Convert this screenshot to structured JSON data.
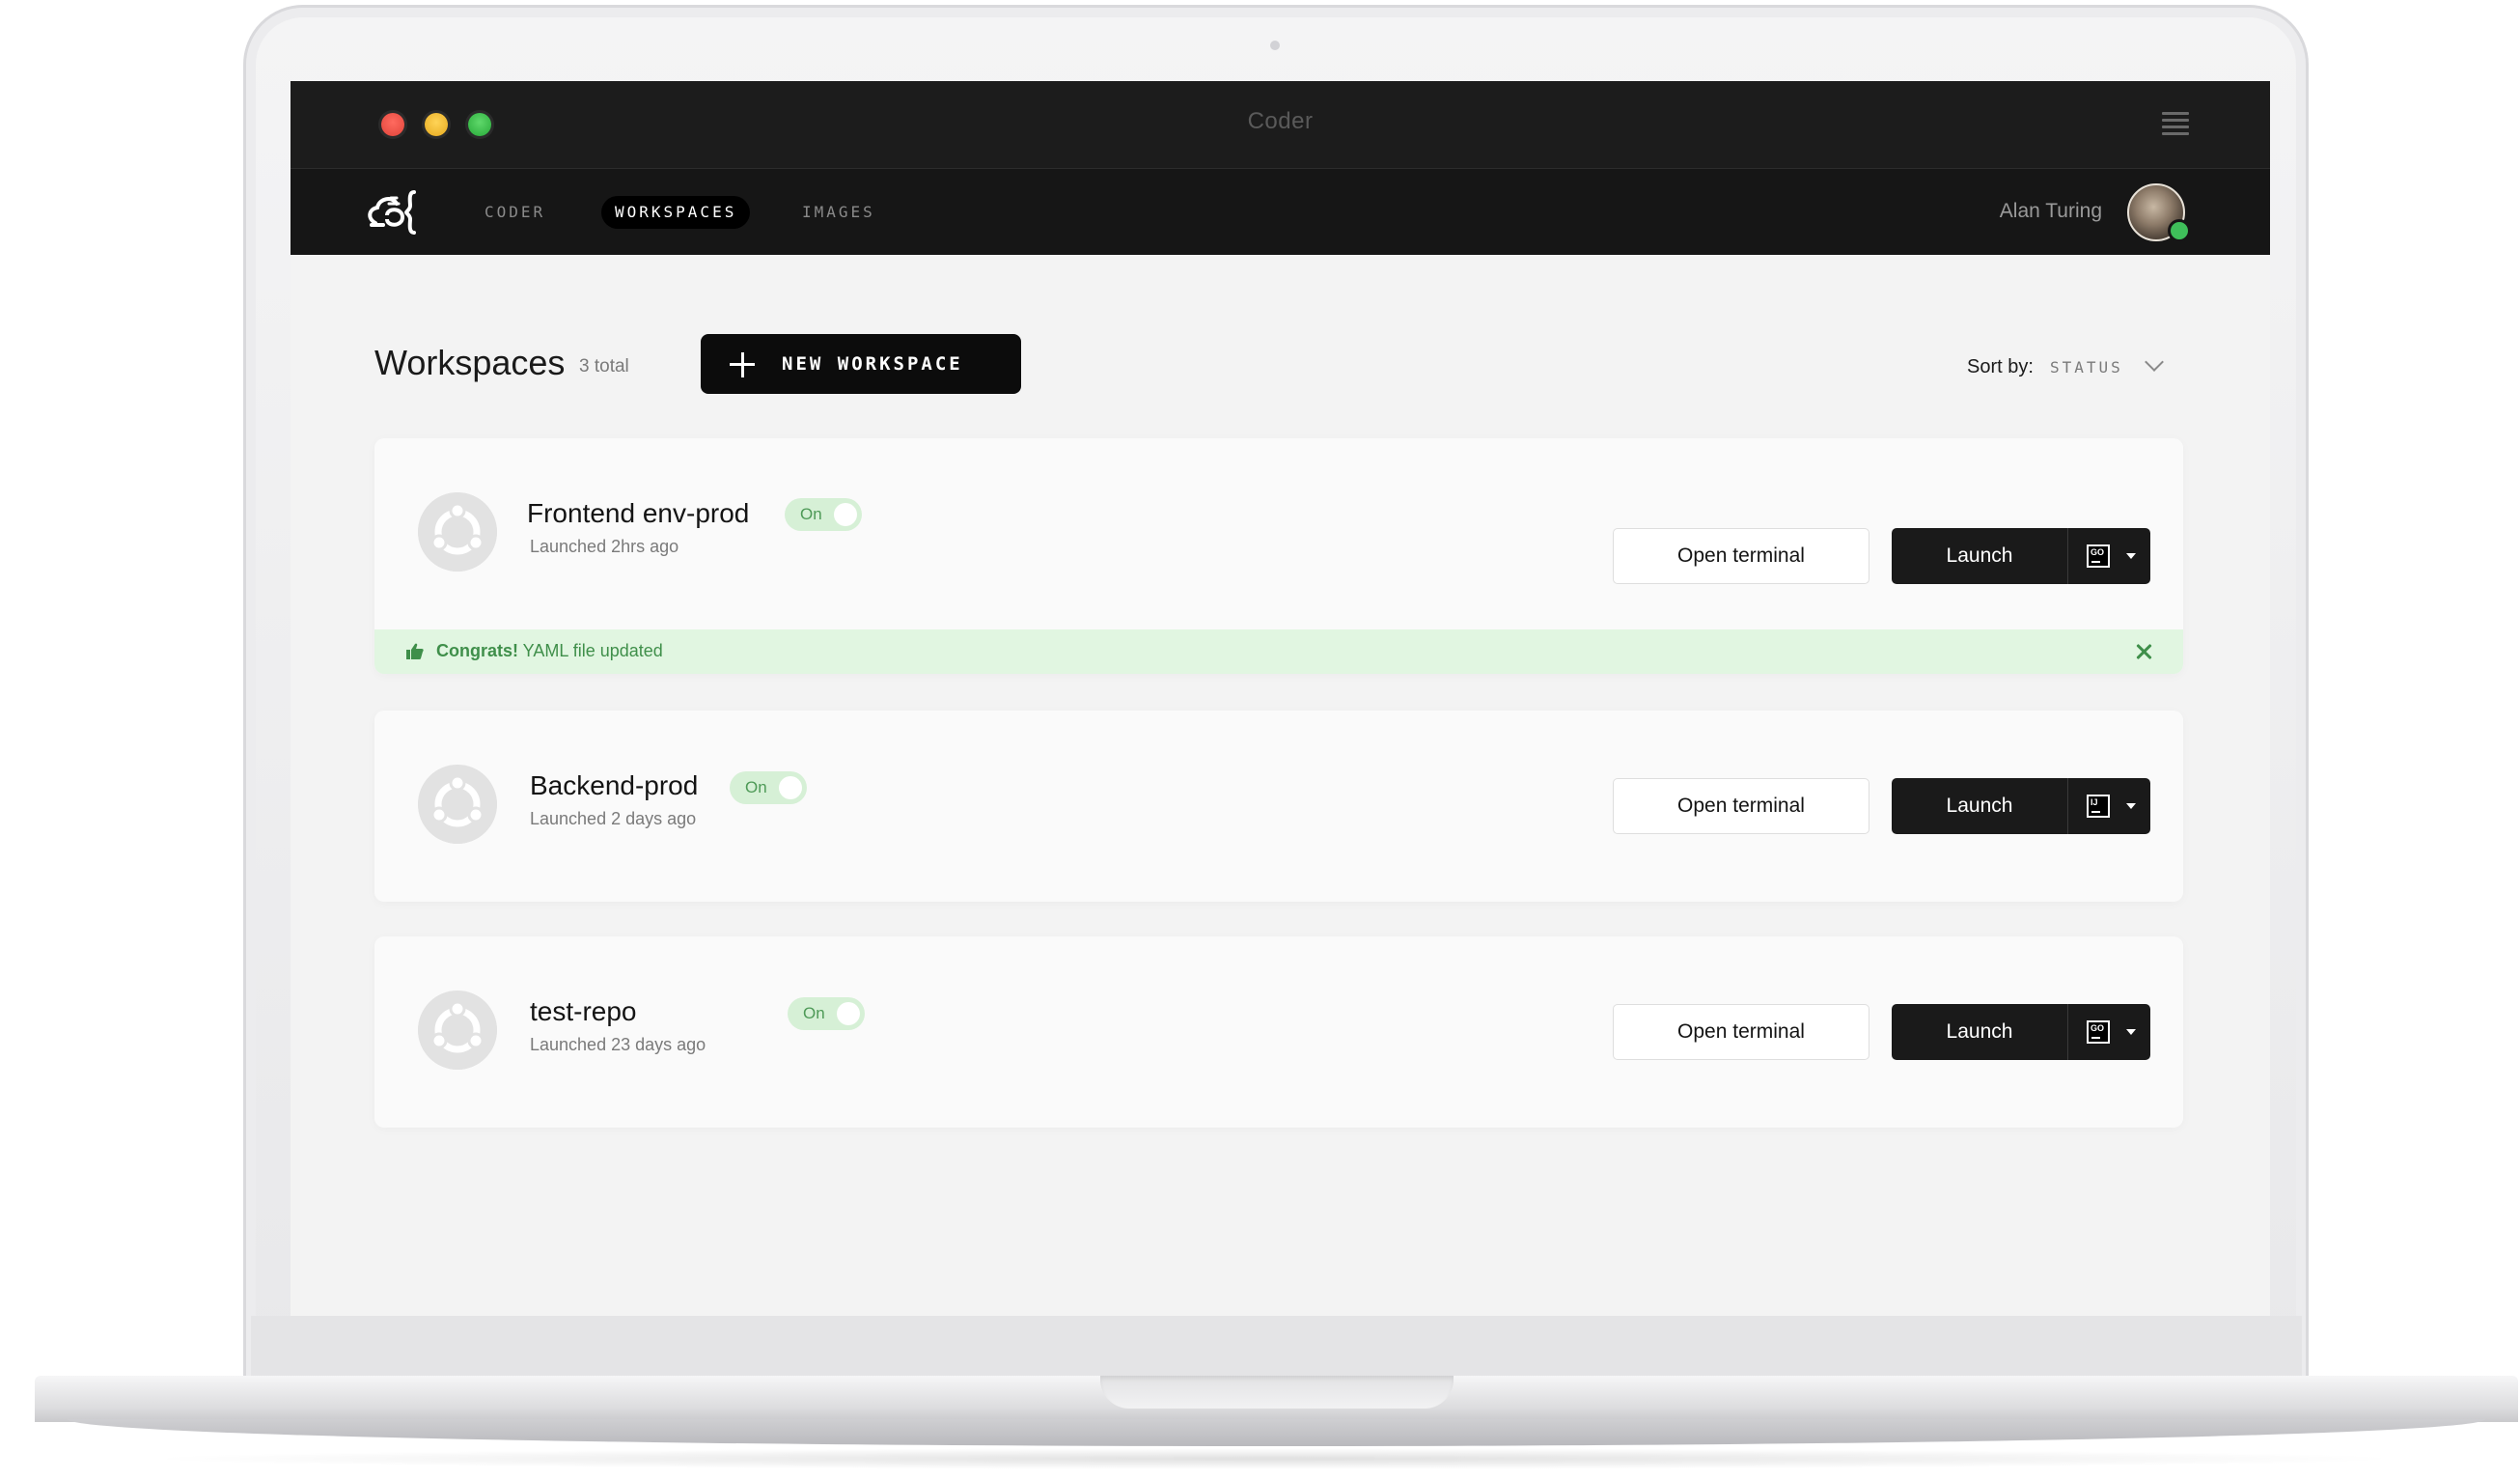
{
  "window": {
    "title": "Coder"
  },
  "nav": {
    "items": [
      {
        "label": "CODER"
      },
      {
        "label": "WORKSPACES"
      },
      {
        "label": "IMAGES"
      }
    ],
    "active": "WORKSPACES",
    "user_name": "Alan Turing"
  },
  "page": {
    "title": "Workspaces",
    "total": "3 total",
    "new_button": "NEW WORKSPACE",
    "sort_label": "Sort by:",
    "sort_value": "STATUS"
  },
  "workspaces": [
    {
      "name": "Frontend env-prod",
      "launched": "Launched 2hrs ago",
      "status": "On",
      "open_terminal": "Open terminal",
      "launch": "Launch",
      "ide": "GO",
      "banner": {
        "bold": "Congrats!",
        "text": " YAML file updated"
      }
    },
    {
      "name": "Backend-prod",
      "launched": "Launched 2 days ago",
      "status": "On",
      "open_terminal": "Open terminal",
      "launch": "Launch",
      "ide": "IJ"
    },
    {
      "name": "test-repo",
      "launched": "Launched 23 days ago",
      "status": "On",
      "open_terminal": "Open terminal",
      "launch": "Launch",
      "ide": "GO"
    }
  ],
  "colors": {
    "accent_dark": "#0c0c0c",
    "status_on_bg": "#d6f0d6",
    "status_on_text": "#4e9a57",
    "banner_bg": "#e1f6e1",
    "online_dot": "#3fbf5a"
  },
  "icons": {
    "logo": "coder-logo",
    "menu": "hamburger-icon",
    "workspace": "ubuntu-icon",
    "banner": "thumbs-up-icon",
    "close": "close-icon",
    "sort": "chevron-down-icon"
  }
}
